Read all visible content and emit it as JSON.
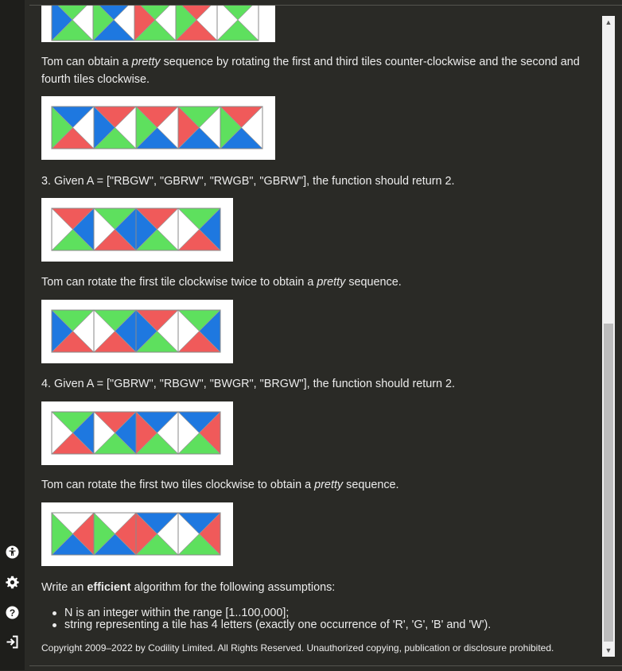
{
  "colors": {
    "R": "#f05a5a",
    "G": "#5ee05e",
    "B": "#1e78e0",
    "W": "#ffffff"
  },
  "tile_rows": {
    "top": [
      "GWGB",
      "BWBG",
      "GWGR",
      "RWRG",
      "GWGW"
    ],
    "ex2_result": [
      "BWRG",
      "RWGB",
      "RWBG",
      "GWBR",
      "RWBG"
    ],
    "ex3": [
      "RBGW",
      "GBRW",
      "RWGB",
      "GBRW"
    ],
    "ex3_result": [
      "GWRB",
      "GBRW",
      "RWGB",
      "GBRW"
    ],
    "ex4": [
      "GBRW",
      "RBGW",
      "BWGR",
      "BRGW"
    ],
    "ex4_result": [
      "WRBG",
      "WRBG",
      "BWGR",
      "BRGW"
    ]
  },
  "text": {
    "p1_pre": "Tom can obtain a ",
    "p1_em": "pretty",
    "p1_post": " sequence by rotating the first and third tiles counter-clockwise and the second and fourth tiles clockwise.",
    "ex3": "3. Given A = [\"RBGW\", \"GBRW\", \"RWGB\", \"GBRW\"], the function should return 2.",
    "p3_pre": "Tom can rotate the first tile clockwise twice to obtain a ",
    "p3_em": "pretty",
    "p3_post": " sequence.",
    "ex4": "4. Given A = [\"GBRW\", \"RBGW\", \"BWGR\", \"BRGW\"], the function should return 2.",
    "p4_pre": "Tom can rotate the first two tiles clockwise to obtain a ",
    "p4_em": "pretty",
    "p4_post": " sequence.",
    "assume_pre": "Write an ",
    "assume_strong": "efficient",
    "assume_post": " algorithm for the following assumptions:",
    "bullet1": "N is an integer within the range [1..100,000];",
    "bullet2": "string representing a tile has 4 letters (exactly one occurrence of 'R', 'G', 'B' and 'W').",
    "copyright": "Copyright 2009–2022 by Codility Limited. All Rights Reserved. Unauthorized copying, publication or disclosure prohibited."
  },
  "icons": [
    "accessibility-icon",
    "gear-icon",
    "help-icon",
    "sign-in-icon"
  ]
}
